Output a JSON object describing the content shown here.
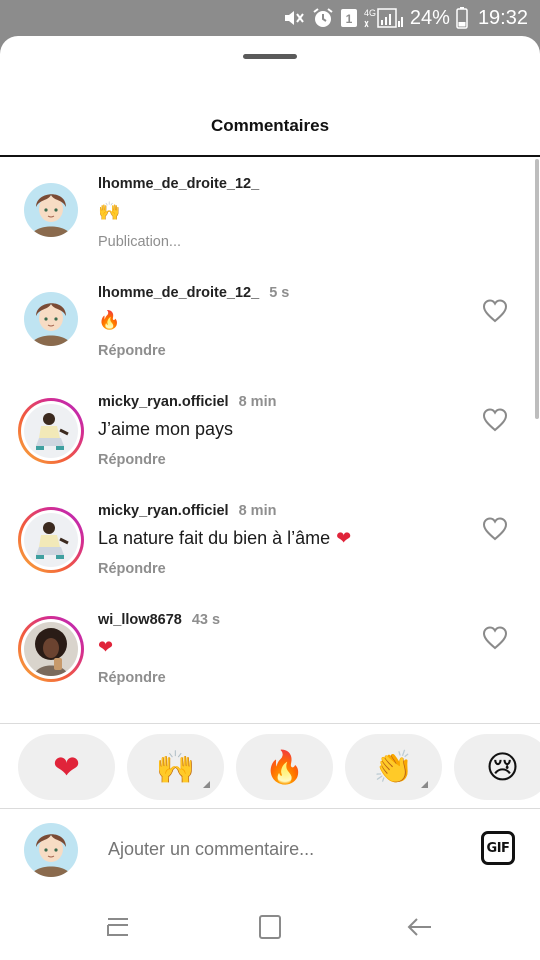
{
  "status_bar": {
    "battery": "24%",
    "time": "19:32",
    "network": "4G",
    "sim_badge": "1",
    "icons": [
      "mute-icon",
      "alarm-icon",
      "sim-icon",
      "signal-icon",
      "battery-icon"
    ]
  },
  "sheet": {
    "title": "Commentaires"
  },
  "comments": [
    {
      "username": "lhomme_de_droite_12_",
      "time": "",
      "text": "🙌",
      "action": "Publication...",
      "avatar": "anime-boy",
      "ring": false,
      "likeable": false
    },
    {
      "username": "lhomme_de_droite_12_",
      "time": "5 s",
      "text": "🔥",
      "action": "Répondre",
      "avatar": "anime-boy",
      "ring": false,
      "likeable": true
    },
    {
      "username": "micky_ryan.officiel",
      "time": "8 min",
      "text": "J’aime mon pays",
      "action": "Répondre",
      "avatar": "man-crouching",
      "ring": true,
      "likeable": true
    },
    {
      "username": "micky_ryan.officiel",
      "time": "8 min",
      "text": "La nature fait du bien à l’âme ❤️",
      "action": "Répondre",
      "avatar": "man-crouching",
      "ring": true,
      "likeable": true
    },
    {
      "username": "wi_llow8678",
      "time": "43 s",
      "text": "❤️",
      "action": "Répondre",
      "avatar": "woman-curly",
      "ring": true,
      "likeable": true
    }
  ],
  "emoji_bar": [
    {
      "emoji": "❤️",
      "name": "red-heart",
      "has_variants": false
    },
    {
      "emoji": "🙌",
      "name": "raising-hands",
      "has_variants": true
    },
    {
      "emoji": "🔥",
      "name": "fire",
      "has_variants": false
    },
    {
      "emoji": "👏",
      "name": "clapping-hands",
      "has_variants": true
    },
    {
      "emoji": "😢",
      "name": "crying-face",
      "has_variants": false
    }
  ],
  "composer": {
    "placeholder": "Ajouter un commentaire...",
    "gif_label": "GIF"
  },
  "navbar": {
    "icons": [
      "recent-apps-icon",
      "home-icon",
      "back-icon"
    ]
  },
  "colors": {
    "heart": "#e0243a",
    "muted_text": "#8e8e8e",
    "story_ring": [
      "#f9b23a",
      "#d62f8c",
      "#b226c7"
    ]
  }
}
